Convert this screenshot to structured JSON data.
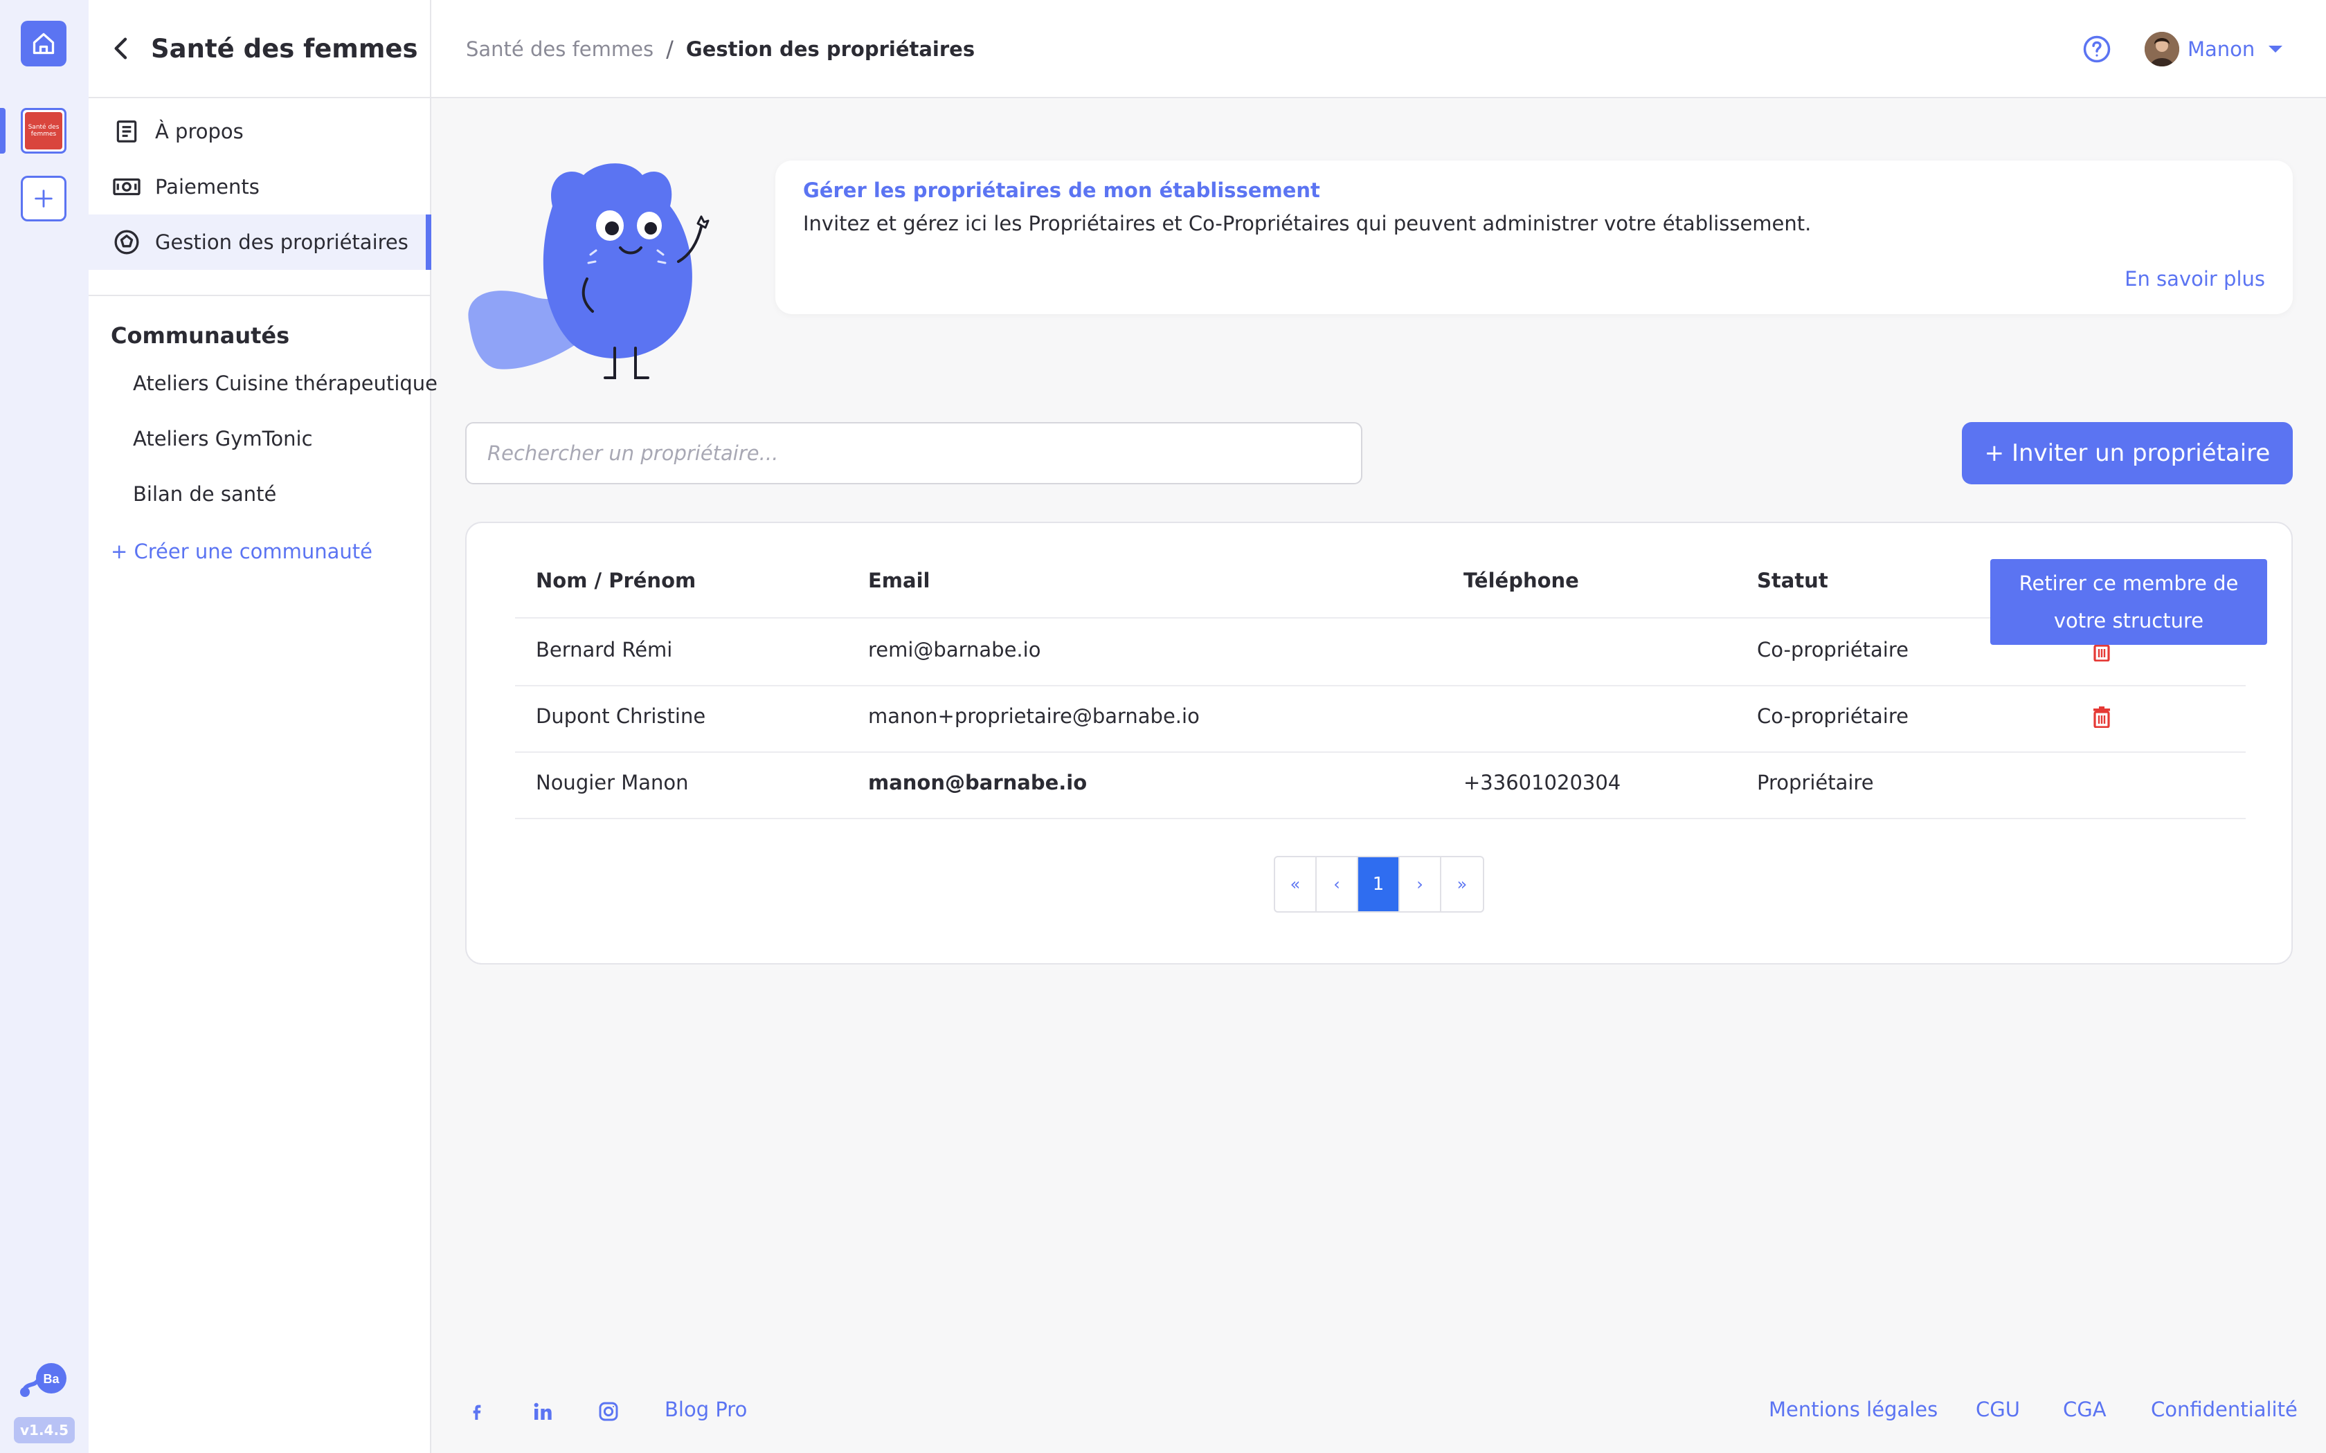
{
  "rail": {
    "home_icon": "home-icon",
    "org_badge_text": "Santé des femmes",
    "add_icon": "plus-icon",
    "logo_text": "Ba",
    "version": "v1.4.5"
  },
  "sidebar": {
    "title": "Santé des femmes",
    "items": [
      {
        "label": "À propos",
        "icon": "document-icon"
      },
      {
        "label": "Paiements",
        "icon": "banknote-icon"
      },
      {
        "label": "Gestion des propriétaires",
        "icon": "badge-icon",
        "active": true
      }
    ],
    "communities_title": "Communautés",
    "communities": [
      "Ateliers Cuisine thérapeutique",
      "Ateliers GymTonic",
      "Bilan de santé"
    ],
    "create_community": "+ Créer une communauté"
  },
  "header": {
    "breadcrumb": [
      "Santé des femmes",
      "Gestion des propriétaires"
    ],
    "separator": "/",
    "user_name": "Manon"
  },
  "info": {
    "title": "Gérer les propriétaires de mon établissement",
    "text": "Invitez et gérez ici les Propriétaires et Co-Propriétaires qui peuvent administrer votre établissement.",
    "more": "En savoir plus"
  },
  "search": {
    "placeholder": "Rechercher un propriétaire..."
  },
  "invite_button": "+ Inviter un propriétaire",
  "table": {
    "columns": [
      "Nom / Prénom",
      "Email",
      "Téléphone",
      "Statut"
    ],
    "rows": [
      {
        "name": "Bernard Rémi",
        "email": "remi@barnabe.io",
        "phone": "",
        "status": "Co-propriétaire",
        "deletable": true
      },
      {
        "name": "Dupont Christine",
        "email": "manon+proprietaire@barnabe.io",
        "phone": "",
        "status": "Co-propriétaire",
        "deletable": true
      },
      {
        "name": "Nougier Manon",
        "email": "manon@barnabe.io",
        "phone": "+33601020304",
        "status": "Propriétaire",
        "deletable": false
      }
    ]
  },
  "tooltip": {
    "line1": "Retirer ce membre de",
    "line2": "votre structure"
  },
  "pagination": {
    "first": "«",
    "prev": "‹",
    "current": "1",
    "next": "›",
    "last": "»"
  },
  "footer": {
    "social_icons": [
      "facebook-icon",
      "linkedin-icon",
      "instagram-icon"
    ],
    "blog": "Blog Pro",
    "links": [
      "Mentions légales",
      "CGU",
      "CGA",
      "Confidentialité"
    ]
  },
  "colors": {
    "accent": "#5b74f2",
    "danger": "#e53935",
    "pager_active": "#2f6df0"
  }
}
